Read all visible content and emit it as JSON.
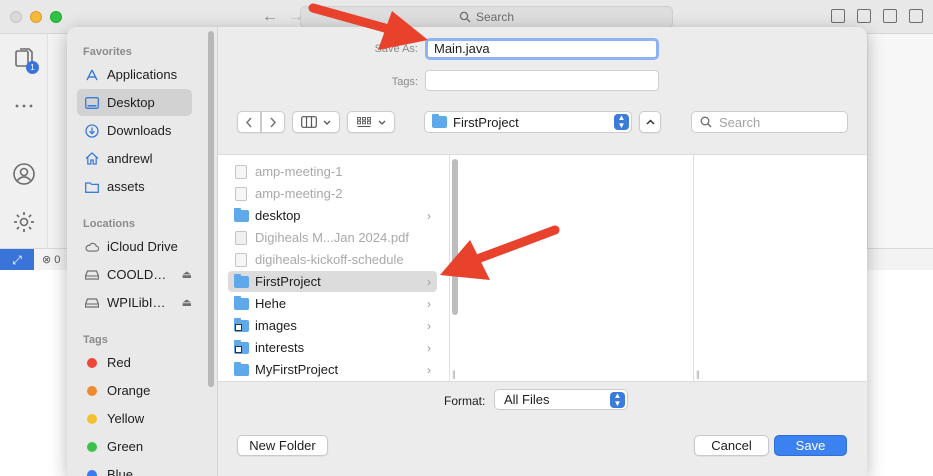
{
  "background_window": {
    "search_placeholder": "Search",
    "badge_count": "1",
    "status_error_count": "0"
  },
  "sidebar": {
    "favorites_header": "Favorites",
    "favorites": [
      {
        "label": "Applications",
        "icon": "applications-icon"
      },
      {
        "label": "Desktop",
        "icon": "desktop-icon",
        "selected": true
      },
      {
        "label": "Downloads",
        "icon": "downloads-icon"
      },
      {
        "label": "andrewl",
        "icon": "home-icon"
      },
      {
        "label": "assets",
        "icon": "folder-icon"
      }
    ],
    "locations_header": "Locations",
    "locations": [
      {
        "label": "iCloud Drive",
        "icon": "cloud-icon"
      },
      {
        "label": "COOLD…",
        "icon": "disk-icon",
        "eject": true
      },
      {
        "label": "WPILibI…",
        "icon": "disk-icon",
        "eject": true
      }
    ],
    "tags_header": "Tags",
    "tags": [
      {
        "label": "Red",
        "color": "#f0453a"
      },
      {
        "label": "Orange",
        "color": "#f08a2e"
      },
      {
        "label": "Yellow",
        "color": "#f2c12e"
      },
      {
        "label": "Green",
        "color": "#3cc24a"
      },
      {
        "label": "Blue",
        "color": "#3a7cf0"
      }
    ]
  },
  "form": {
    "save_as_label": "Save As:",
    "save_as_value": "Main.java",
    "tags_label": "Tags:",
    "location": "FirstProject",
    "search_placeholder": "Search"
  },
  "files": [
    {
      "name": "amp-meeting-1",
      "type": "doc",
      "disabled": true
    },
    {
      "name": "amp-meeting-2",
      "type": "doc",
      "disabled": true
    },
    {
      "name": "desktop",
      "type": "folder",
      "chevron": true
    },
    {
      "name": "Digiheals M...Jan 2024.pdf",
      "type": "pdf",
      "disabled": true
    },
    {
      "name": "digiheals-kickoff-schedule",
      "type": "doc",
      "disabled": true
    },
    {
      "name": "FirstProject",
      "type": "folder",
      "chevron": true,
      "selected": true
    },
    {
      "name": "Hehe",
      "type": "folder",
      "chevron": true
    },
    {
      "name": "images",
      "type": "alias-folder",
      "chevron": true
    },
    {
      "name": "interests",
      "type": "alias-folder",
      "chevron": true
    },
    {
      "name": "MyFirstProject",
      "type": "folder",
      "chevron": true
    }
  ],
  "format": {
    "label": "Format:",
    "value": "All Files"
  },
  "buttons": {
    "new_folder": "New Folder",
    "cancel": "Cancel",
    "save": "Save"
  },
  "colors": {
    "accent": "#3b82f0",
    "annotation_arrow": "#e8412c"
  }
}
